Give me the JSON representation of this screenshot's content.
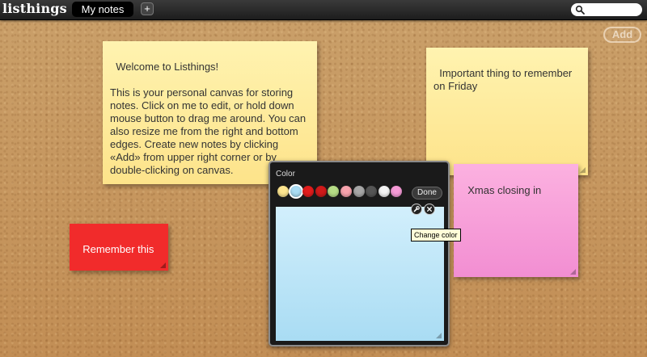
{
  "header": {
    "logo": "listhings",
    "tab_label": "My notes",
    "add_tab_label": "+",
    "search_placeholder": ""
  },
  "toolbar": {
    "add_label": "Add"
  },
  "notes": {
    "welcome": "Welcome to Listhings!\n\nThis is your personal canvas for storing notes. Click on me to edit, or hold down mouse button to drag me around. You can also resize me from the right and bottom edges. Create new notes by clicking «Add» from upper right corner or by double-clicking on canvas.",
    "important": "Important thing to remember on Friday",
    "xmas": "Xmas closing in",
    "remember": "Remember this"
  },
  "color_panel": {
    "title": "Color",
    "done_label": "Done",
    "swatches": [
      "#fde58f",
      "#a9dcf3",
      "#e11c1c",
      "#cf1a1a",
      "#b6dc86",
      "#f7a3ad",
      "#a7a7a7",
      "#555555",
      "#f3f3f3",
      "#f59ad6"
    ],
    "selected": "#a9dcf3",
    "tooltip": "Change color"
  },
  "icons": {
    "search": "search-icon",
    "wrench": "wrench-icon",
    "close": "close-icon",
    "resize": "resize-grip-icon"
  }
}
